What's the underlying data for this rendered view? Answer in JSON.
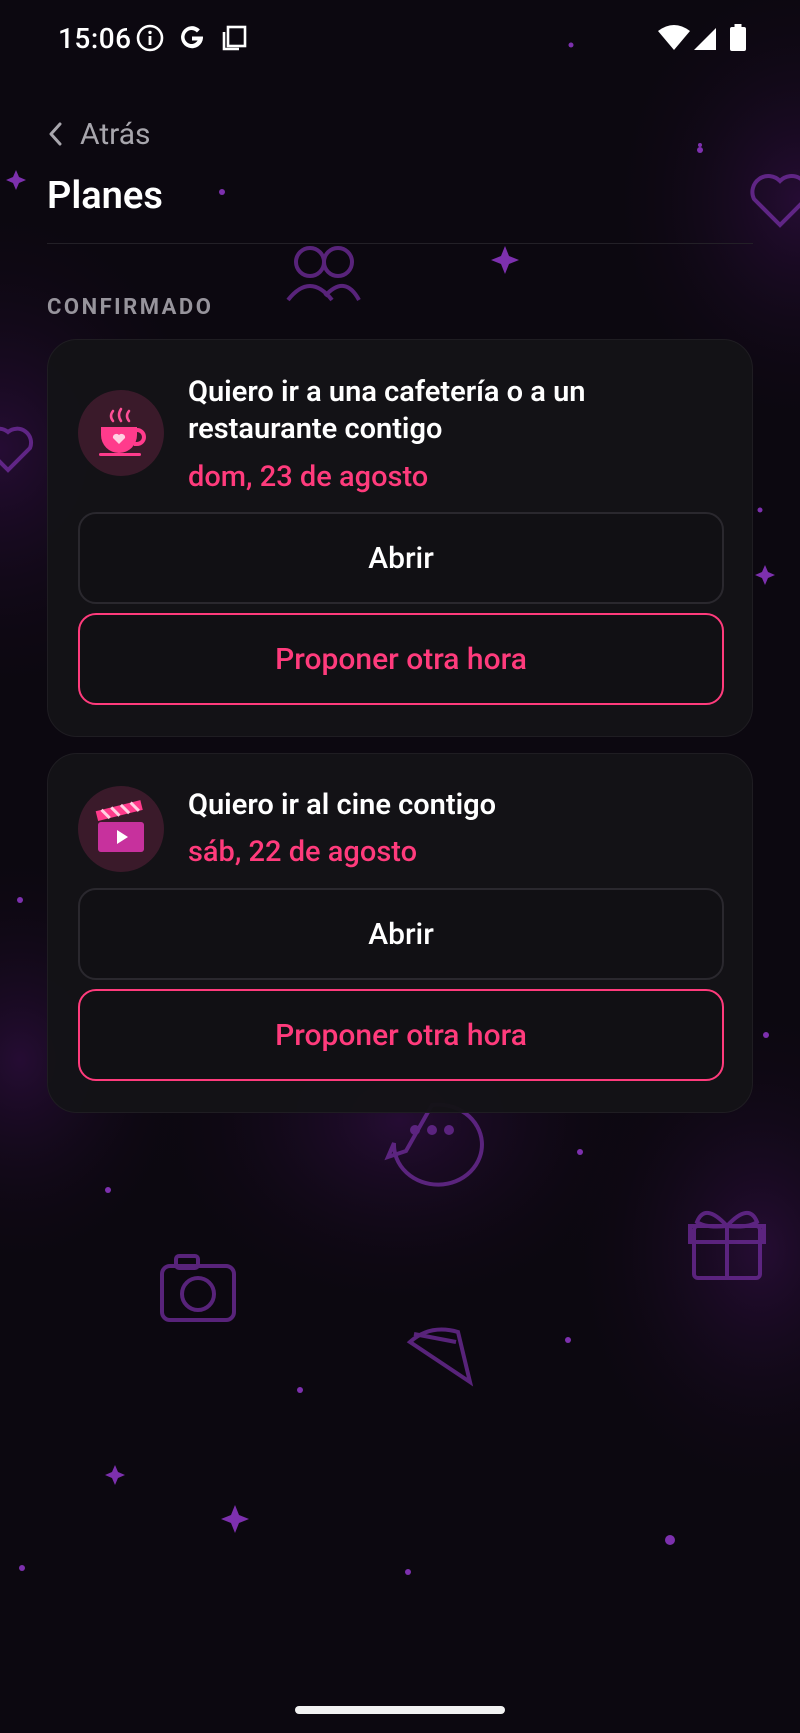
{
  "status_bar": {
    "time": "15:06",
    "left_icons": [
      "info-icon",
      "google-icon",
      "copy-icon"
    ],
    "right_icons": [
      "wifi-icon",
      "signal-icon",
      "battery-icon"
    ]
  },
  "header": {
    "back_label": "Atrás",
    "title": "Planes"
  },
  "section": {
    "label": "CONFIRMADO"
  },
  "plans": [
    {
      "icon": "coffee-cup-icon",
      "title": "Quiero ir a una cafetería o a un restaurante contigo",
      "date": "dom, 23 de agosto",
      "open_label": "Abrir",
      "propose_label": "Proponer otra hora"
    },
    {
      "icon": "clapperboard-icon",
      "title": "Quiero ir al cine contigo",
      "date": "sáb, 22 de agosto",
      "open_label": "Abrir",
      "propose_label": "Proponer otra hora"
    }
  ],
  "colors": {
    "background": "#0c0810",
    "card": "#141317",
    "accent": "#ff3b7c",
    "muted_text": "#97949c",
    "decor": "#7a2fa8"
  }
}
